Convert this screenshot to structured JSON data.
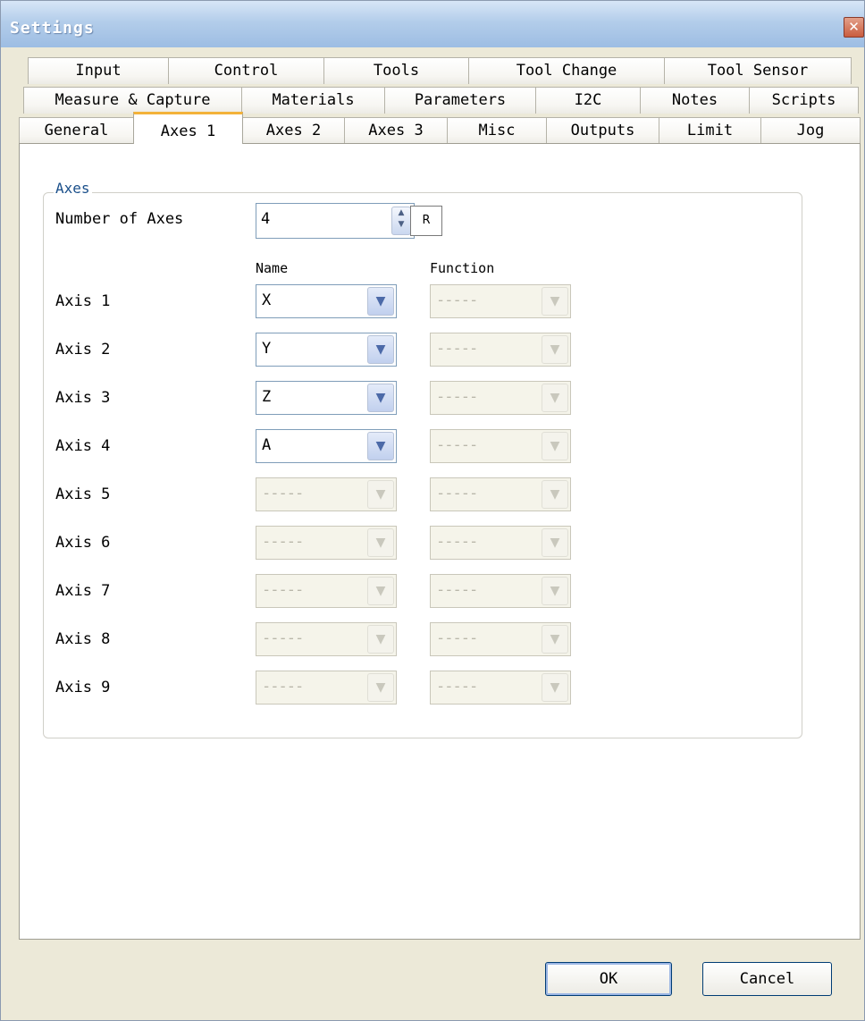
{
  "window": {
    "title": "Settings",
    "close_icon": "close-icon"
  },
  "tabs": {
    "row1": [
      "Input",
      "Control",
      "Tools",
      "Tool Change",
      "Tool Sensor"
    ],
    "row2": [
      "Measure & Capture",
      "Materials",
      "Parameters",
      "I2C",
      "Notes",
      "Scripts"
    ],
    "row3": [
      "General",
      "Axes 1",
      "Axes 2",
      "Axes 3",
      "Misc",
      "Outputs",
      "Limit",
      "Jog"
    ],
    "active": "Axes 1"
  },
  "axes_group": {
    "legend": "Axes",
    "number_of_axes_label": "Number of Axes",
    "number_of_axes_value": "4",
    "reset_label": "R",
    "name_header": "Name",
    "function_header": "Function",
    "rows": [
      {
        "label": "Axis 1",
        "name": "X",
        "function": "-----",
        "name_enabled": true
      },
      {
        "label": "Axis 2",
        "name": "Y",
        "function": "-----",
        "name_enabled": true
      },
      {
        "label": "Axis 3",
        "name": "Z",
        "function": "-----",
        "name_enabled": true
      },
      {
        "label": "Axis 4",
        "name": "A",
        "function": "-----",
        "name_enabled": true
      },
      {
        "label": "Axis 5",
        "name": "-----",
        "function": "-----",
        "name_enabled": false
      },
      {
        "label": "Axis 6",
        "name": "-----",
        "function": "-----",
        "name_enabled": false
      },
      {
        "label": "Axis 7",
        "name": "-----",
        "function": "-----",
        "name_enabled": false
      },
      {
        "label": "Axis 8",
        "name": "-----",
        "function": "-----",
        "name_enabled": false
      },
      {
        "label": "Axis 9",
        "name": "-----",
        "function": "-----",
        "name_enabled": false
      }
    ]
  },
  "footer": {
    "ok_label": "OK",
    "cancel_label": "Cancel"
  },
  "colors": {
    "title_bar": "#b3cdea",
    "active_tab_accent": "#f3b23a",
    "legend_text": "#1a4f8a"
  }
}
